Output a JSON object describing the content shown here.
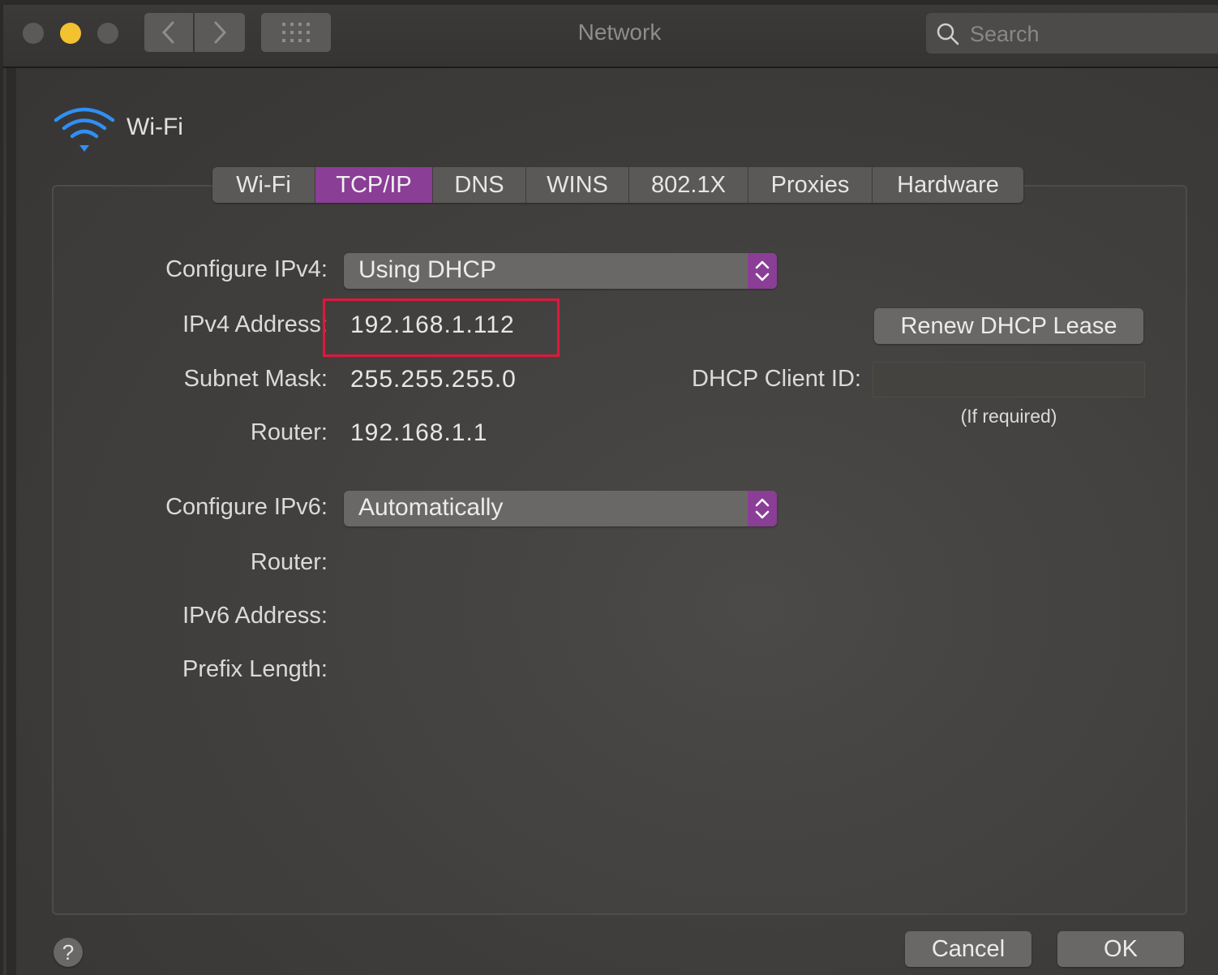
{
  "window": {
    "title": "Network",
    "search_placeholder": "Search"
  },
  "service": {
    "name": "Wi-Fi",
    "icon": "wifi-icon"
  },
  "tabs": [
    {
      "label": "Wi-Fi",
      "active": false
    },
    {
      "label": "TCP/IP",
      "active": true
    },
    {
      "label": "DNS",
      "active": false
    },
    {
      "label": "WINS",
      "active": false
    },
    {
      "label": "802.1X",
      "active": false
    },
    {
      "label": "Proxies",
      "active": false
    },
    {
      "label": "Hardware",
      "active": false
    }
  ],
  "ipv4": {
    "configure_label": "Configure IPv4:",
    "configure_value": "Using DHCP",
    "address_label": "IPv4 Address:",
    "address_value": "192.168.1.112",
    "subnet_label": "Subnet Mask:",
    "subnet_value": "255.255.255.0",
    "router_label": "Router:",
    "router_value": "192.168.1.1"
  },
  "dhcp": {
    "renew_label": "Renew DHCP Lease",
    "client_id_label": "DHCP Client ID:",
    "client_id_value": "",
    "client_id_hint": "(If required)"
  },
  "ipv6": {
    "configure_label": "Configure IPv6:",
    "configure_value": "Automatically",
    "router_label": "Router:",
    "address_label": "IPv6 Address:",
    "prefix_label": "Prefix Length:"
  },
  "footer": {
    "help_label": "?",
    "cancel_label": "Cancel",
    "ok_label": "OK"
  },
  "colors": {
    "accent": "#8a3e96",
    "highlight_box": "#e0173d",
    "minimize_light": "#f2c230",
    "wifi_icon": "#2f8ff5"
  }
}
